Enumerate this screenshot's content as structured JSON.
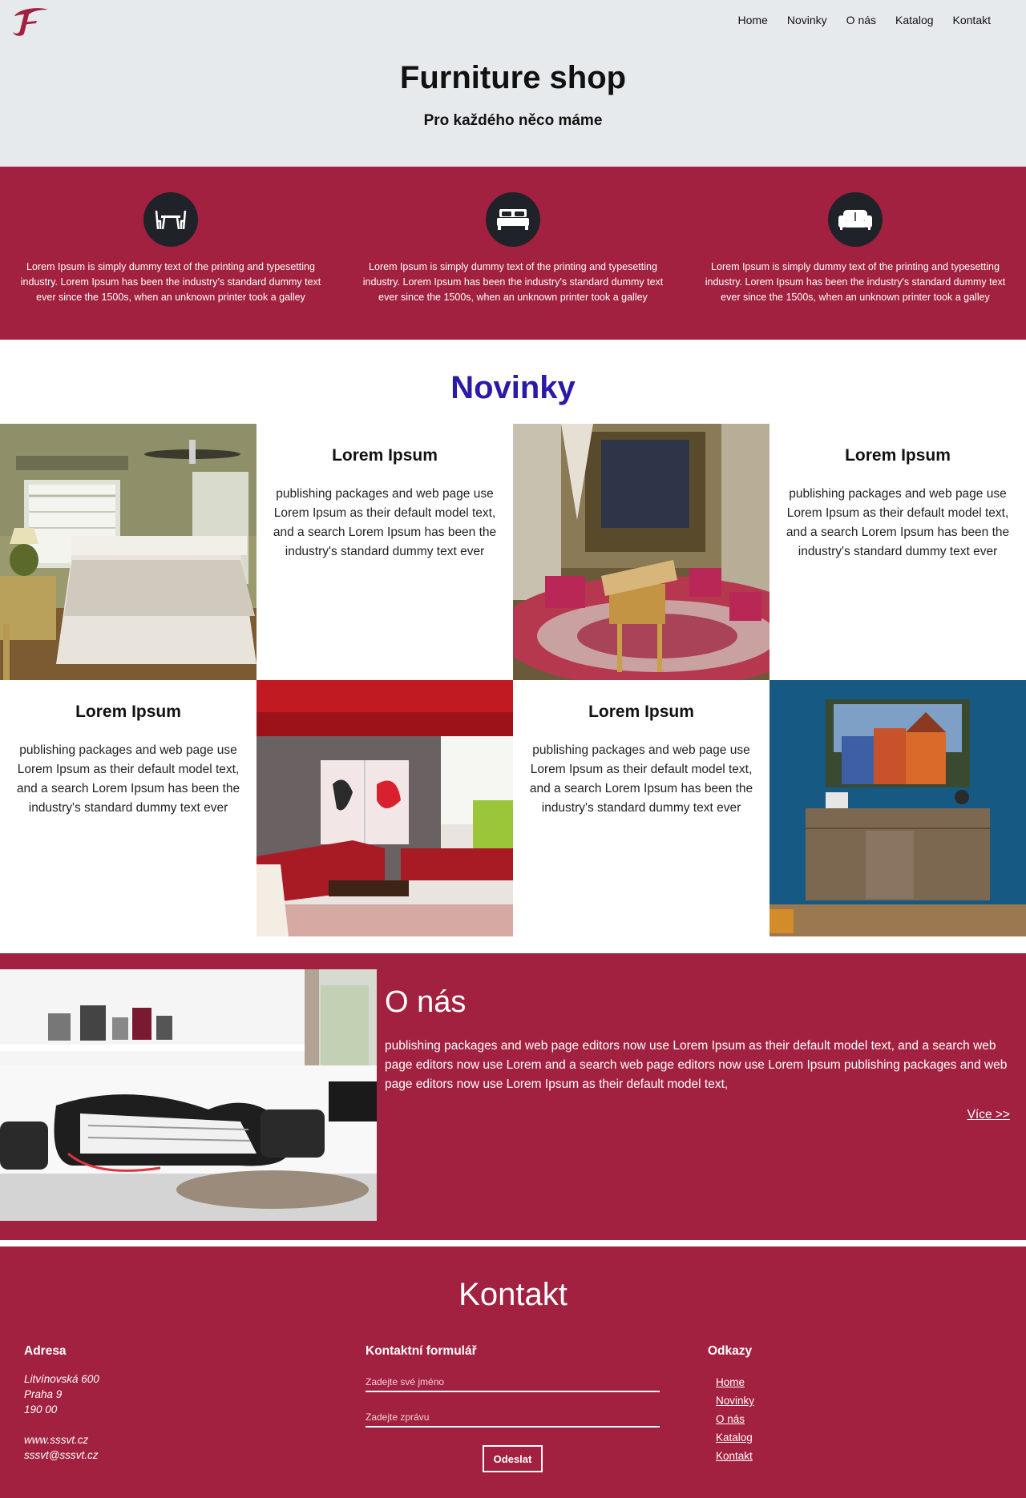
{
  "header": {
    "logo_icon": "script-f-logo",
    "nav": [
      "Home",
      "Novinky",
      "O nás",
      "Katalog",
      "Kontakt"
    ],
    "title": "Furniture shop",
    "subtitle": "Pro každého něco máme"
  },
  "features": [
    {
      "icon": "table-chairs-icon",
      "text": "Lorem Ipsum is simply dummy text of the printing and typesetting industry. Lorem Ipsum has been the industry's standard dummy text ever since the 1500s, when an unknown printer took a galley"
    },
    {
      "icon": "bed-icon",
      "text": "Lorem Ipsum is simply dummy text of the printing and typesetting industry. Lorem Ipsum has been the industry's standard dummy text ever since the 1500s, when an unknown printer took a galley"
    },
    {
      "icon": "sofa-icon",
      "text": "Lorem Ipsum is simply dummy text of the printing and typesetting industry. Lorem Ipsum has been the industry's standard dummy text ever since the 1500s, when an unknown printer took a galley"
    }
  ],
  "novinky": {
    "title": "Novinky",
    "items": [
      {
        "heading": "Lorem Ipsum",
        "text": "publishing packages and web page use Lorem Ipsum as their default model text, and a search Lorem Ipsum has been the industry's standard dummy text ever"
      },
      {
        "heading": "Lorem Ipsum",
        "text": "publishing packages and web page use Lorem Ipsum as their default model text, and a search Lorem Ipsum has been the industry's standard dummy text ever"
      },
      {
        "heading": "Lorem Ipsum",
        "text": "publishing packages and web page use Lorem Ipsum as their default model text, and a search Lorem Ipsum has been the industry's standard dummy text ever"
      },
      {
        "heading": "Lorem Ipsum",
        "text": "publishing packages and web page use Lorem Ipsum as their default model text, and a search Lorem Ipsum has been the industry's standard dummy text ever"
      }
    ]
  },
  "onas": {
    "title": "O nás",
    "text": "publishing packages and web page editors now use Lorem Ipsum as their default model text, and a search web page editors now use Lorem and a search web page editors now use Lorem Ipsum publishing packages and web page editors now use Lorem Ipsum as their default model text,",
    "more": "Více >>"
  },
  "kontakt": {
    "title": "Kontakt",
    "address": {
      "title": "Adresa",
      "lines": [
        "Litvínovská 600",
        "Praha 9",
        "190 00",
        "",
        "www.sssvt.cz",
        "sssvt@sssvt.cz"
      ]
    },
    "form": {
      "title": "Kontaktní formulář",
      "name_placeholder": "Zadejte své jméno",
      "message_placeholder": "Zadejte zprávu",
      "submit": "Odeslat"
    },
    "links": {
      "title": "Odkazy",
      "items": [
        "Home",
        "Novinky",
        "O nás",
        "Katalog",
        "Kontakt"
      ]
    }
  },
  "colors": {
    "accent": "#a22040",
    "header_bg": "#e7eaed",
    "novinky_title": "#2a1aa8",
    "icon_circle": "#1f2229"
  }
}
